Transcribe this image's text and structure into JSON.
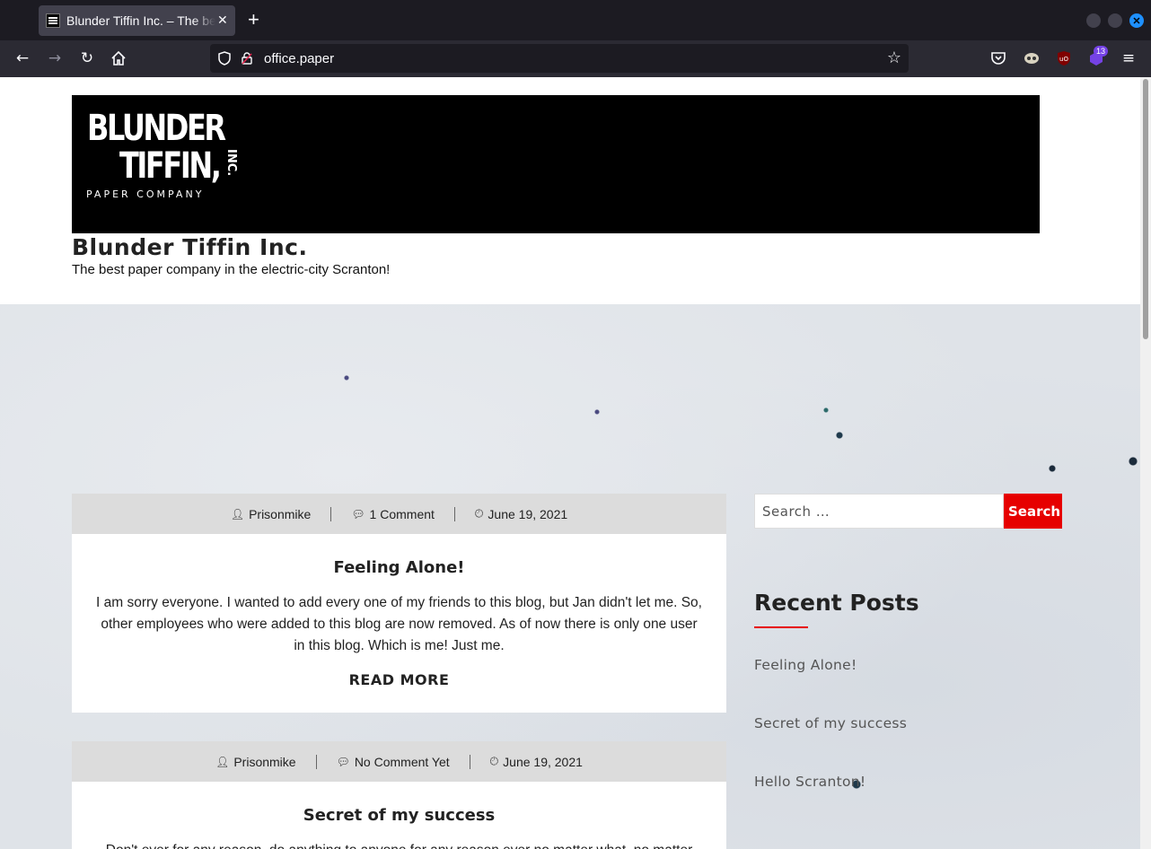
{
  "browser": {
    "tab_title": "Blunder Tiffin Inc. – The be",
    "url": "office.paper",
    "extension_badge": "13"
  },
  "site": {
    "logo_line1": "BLUNDER",
    "logo_line2": "TIFFIN,",
    "logo_inc": "INC.",
    "logo_sub": "PAPER COMPANY",
    "title": "Blunder Tiffin Inc.",
    "tagline": "The best paper company in the electric-city Scranton!"
  },
  "posts": [
    {
      "author": "Prisonmike",
      "comments": "1 Comment",
      "date": "June 19, 2021",
      "title": "Feeling Alone!",
      "excerpt": "I am sorry everyone. I wanted to add every one of my friends to this blog, but Jan didn't let me. So, other employees who were added to this blog are now removed. As of now there is only one user in this blog. Which is me! Just me.",
      "read_more": "READ MORE"
    },
    {
      "author": "Prisonmike",
      "comments": "No Comment Yet",
      "date": "June 19, 2021",
      "title": "Secret of my success",
      "excerpt": "Don't ever for any reason, do anything to anyone for any reason ever no matter what, no matter"
    }
  ],
  "sidebar": {
    "search_placeholder": "Search …",
    "search_button": "Search",
    "recent_title": "Recent Posts",
    "recent_posts": [
      "Feeling Alone!",
      "Secret of my success",
      "Hello Scranton!"
    ]
  },
  "colors": {
    "accent": "#e60000",
    "meta_bar": "#dcdcdc",
    "browser_dark": "#1c1b22"
  }
}
